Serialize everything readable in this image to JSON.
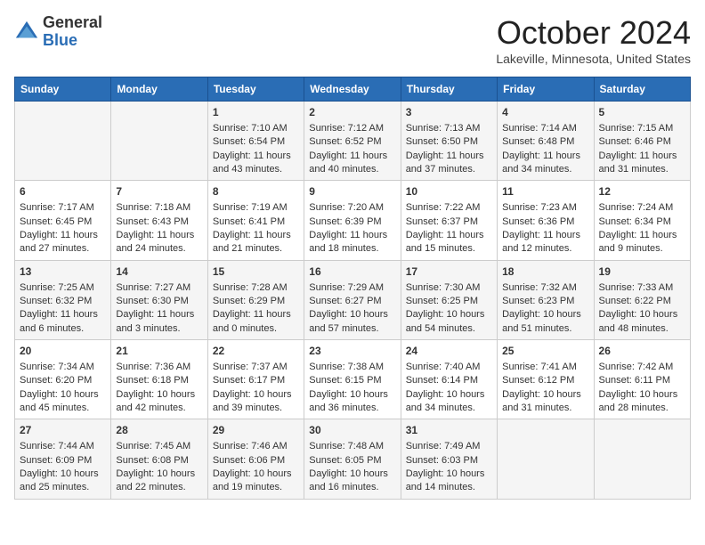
{
  "header": {
    "logo_general": "General",
    "logo_blue": "Blue",
    "month": "October 2024",
    "location": "Lakeville, Minnesota, United States"
  },
  "days_of_week": [
    "Sunday",
    "Monday",
    "Tuesday",
    "Wednesday",
    "Thursday",
    "Friday",
    "Saturday"
  ],
  "weeks": [
    [
      {
        "day": "",
        "sunrise": "",
        "sunset": "",
        "daylight": ""
      },
      {
        "day": "",
        "sunrise": "",
        "sunset": "",
        "daylight": ""
      },
      {
        "day": "1",
        "sunrise": "Sunrise: 7:10 AM",
        "sunset": "Sunset: 6:54 PM",
        "daylight": "Daylight: 11 hours and 43 minutes."
      },
      {
        "day": "2",
        "sunrise": "Sunrise: 7:12 AM",
        "sunset": "Sunset: 6:52 PM",
        "daylight": "Daylight: 11 hours and 40 minutes."
      },
      {
        "day": "3",
        "sunrise": "Sunrise: 7:13 AM",
        "sunset": "Sunset: 6:50 PM",
        "daylight": "Daylight: 11 hours and 37 minutes."
      },
      {
        "day": "4",
        "sunrise": "Sunrise: 7:14 AM",
        "sunset": "Sunset: 6:48 PM",
        "daylight": "Daylight: 11 hours and 34 minutes."
      },
      {
        "day": "5",
        "sunrise": "Sunrise: 7:15 AM",
        "sunset": "Sunset: 6:46 PM",
        "daylight": "Daylight: 11 hours and 31 minutes."
      }
    ],
    [
      {
        "day": "6",
        "sunrise": "Sunrise: 7:17 AM",
        "sunset": "Sunset: 6:45 PM",
        "daylight": "Daylight: 11 hours and 27 minutes."
      },
      {
        "day": "7",
        "sunrise": "Sunrise: 7:18 AM",
        "sunset": "Sunset: 6:43 PM",
        "daylight": "Daylight: 11 hours and 24 minutes."
      },
      {
        "day": "8",
        "sunrise": "Sunrise: 7:19 AM",
        "sunset": "Sunset: 6:41 PM",
        "daylight": "Daylight: 11 hours and 21 minutes."
      },
      {
        "day": "9",
        "sunrise": "Sunrise: 7:20 AM",
        "sunset": "Sunset: 6:39 PM",
        "daylight": "Daylight: 11 hours and 18 minutes."
      },
      {
        "day": "10",
        "sunrise": "Sunrise: 7:22 AM",
        "sunset": "Sunset: 6:37 PM",
        "daylight": "Daylight: 11 hours and 15 minutes."
      },
      {
        "day": "11",
        "sunrise": "Sunrise: 7:23 AM",
        "sunset": "Sunset: 6:36 PM",
        "daylight": "Daylight: 11 hours and 12 minutes."
      },
      {
        "day": "12",
        "sunrise": "Sunrise: 7:24 AM",
        "sunset": "Sunset: 6:34 PM",
        "daylight": "Daylight: 11 hours and 9 minutes."
      }
    ],
    [
      {
        "day": "13",
        "sunrise": "Sunrise: 7:25 AM",
        "sunset": "Sunset: 6:32 PM",
        "daylight": "Daylight: 11 hours and 6 minutes."
      },
      {
        "day": "14",
        "sunrise": "Sunrise: 7:27 AM",
        "sunset": "Sunset: 6:30 PM",
        "daylight": "Daylight: 11 hours and 3 minutes."
      },
      {
        "day": "15",
        "sunrise": "Sunrise: 7:28 AM",
        "sunset": "Sunset: 6:29 PM",
        "daylight": "Daylight: 11 hours and 0 minutes."
      },
      {
        "day": "16",
        "sunrise": "Sunrise: 7:29 AM",
        "sunset": "Sunset: 6:27 PM",
        "daylight": "Daylight: 10 hours and 57 minutes."
      },
      {
        "day": "17",
        "sunrise": "Sunrise: 7:30 AM",
        "sunset": "Sunset: 6:25 PM",
        "daylight": "Daylight: 10 hours and 54 minutes."
      },
      {
        "day": "18",
        "sunrise": "Sunrise: 7:32 AM",
        "sunset": "Sunset: 6:23 PM",
        "daylight": "Daylight: 10 hours and 51 minutes."
      },
      {
        "day": "19",
        "sunrise": "Sunrise: 7:33 AM",
        "sunset": "Sunset: 6:22 PM",
        "daylight": "Daylight: 10 hours and 48 minutes."
      }
    ],
    [
      {
        "day": "20",
        "sunrise": "Sunrise: 7:34 AM",
        "sunset": "Sunset: 6:20 PM",
        "daylight": "Daylight: 10 hours and 45 minutes."
      },
      {
        "day": "21",
        "sunrise": "Sunrise: 7:36 AM",
        "sunset": "Sunset: 6:18 PM",
        "daylight": "Daylight: 10 hours and 42 minutes."
      },
      {
        "day": "22",
        "sunrise": "Sunrise: 7:37 AM",
        "sunset": "Sunset: 6:17 PM",
        "daylight": "Daylight: 10 hours and 39 minutes."
      },
      {
        "day": "23",
        "sunrise": "Sunrise: 7:38 AM",
        "sunset": "Sunset: 6:15 PM",
        "daylight": "Daylight: 10 hours and 36 minutes."
      },
      {
        "day": "24",
        "sunrise": "Sunrise: 7:40 AM",
        "sunset": "Sunset: 6:14 PM",
        "daylight": "Daylight: 10 hours and 34 minutes."
      },
      {
        "day": "25",
        "sunrise": "Sunrise: 7:41 AM",
        "sunset": "Sunset: 6:12 PM",
        "daylight": "Daylight: 10 hours and 31 minutes."
      },
      {
        "day": "26",
        "sunrise": "Sunrise: 7:42 AM",
        "sunset": "Sunset: 6:11 PM",
        "daylight": "Daylight: 10 hours and 28 minutes."
      }
    ],
    [
      {
        "day": "27",
        "sunrise": "Sunrise: 7:44 AM",
        "sunset": "Sunset: 6:09 PM",
        "daylight": "Daylight: 10 hours and 25 minutes."
      },
      {
        "day": "28",
        "sunrise": "Sunrise: 7:45 AM",
        "sunset": "Sunset: 6:08 PM",
        "daylight": "Daylight: 10 hours and 22 minutes."
      },
      {
        "day": "29",
        "sunrise": "Sunrise: 7:46 AM",
        "sunset": "Sunset: 6:06 PM",
        "daylight": "Daylight: 10 hours and 19 minutes."
      },
      {
        "day": "30",
        "sunrise": "Sunrise: 7:48 AM",
        "sunset": "Sunset: 6:05 PM",
        "daylight": "Daylight: 10 hours and 16 minutes."
      },
      {
        "day": "31",
        "sunrise": "Sunrise: 7:49 AM",
        "sunset": "Sunset: 6:03 PM",
        "daylight": "Daylight: 10 hours and 14 minutes."
      },
      {
        "day": "",
        "sunrise": "",
        "sunset": "",
        "daylight": ""
      },
      {
        "day": "",
        "sunrise": "",
        "sunset": "",
        "daylight": ""
      }
    ]
  ]
}
